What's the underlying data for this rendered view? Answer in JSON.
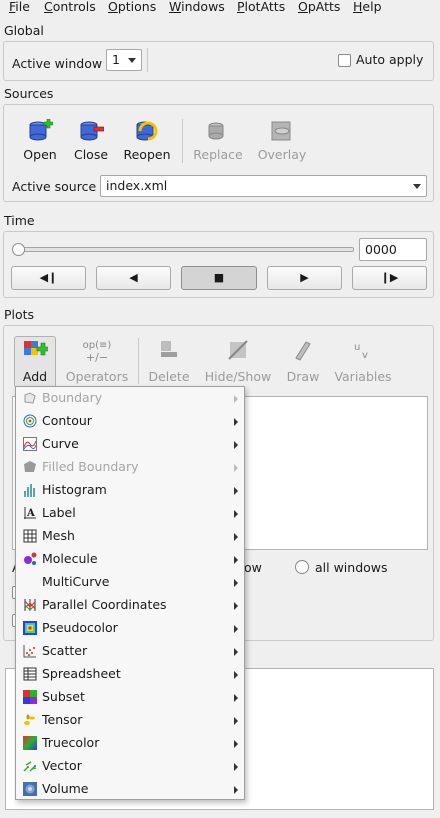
{
  "menubar": {
    "items": [
      {
        "label": "File",
        "ul": "F",
        "rest": "ile"
      },
      {
        "label": "Controls",
        "ul": "C",
        "rest": "ontrols"
      },
      {
        "label": "Options",
        "ul": "O",
        "rest": "ptions"
      },
      {
        "label": "Windows",
        "ul": "W",
        "rest": "indows"
      },
      {
        "label": "PlotAtts",
        "ul": "P",
        "rest": "lotAtts"
      },
      {
        "label": "OpAtts",
        "ul": "O",
        "rest": "pAtts"
      },
      {
        "label": "Help",
        "ul": "H",
        "rest": "elp"
      }
    ]
  },
  "global": {
    "title": "Global",
    "active_window_label": "Active window",
    "active_window_value": "1",
    "auto_apply_label": "Auto apply",
    "auto_apply_checked": false
  },
  "sources": {
    "title": "Sources",
    "buttons": {
      "open": "Open",
      "close": "Close",
      "reopen": "Reopen",
      "replace": "Replace",
      "overlay": "Overlay"
    },
    "active_source_label": "Active source",
    "active_source_value": "index.xml"
  },
  "time": {
    "title": "Time",
    "state_value": "0000",
    "slider_position": 0,
    "buttons": [
      "◀❙",
      "◀",
      "■",
      "▶",
      "❙▶"
    ]
  },
  "plots": {
    "title": "Plots",
    "toolbar": {
      "add": "Add",
      "operators": "Operators",
      "delete": "Delete",
      "hide_show": "Hide/Show",
      "draw": "Draw",
      "variables": "Variables"
    },
    "operators_icon_text": "op(≡)",
    "apply_suffix": "ow",
    "all_windows_label": "all windows",
    "partial_label_a": "A"
  },
  "add_menu": {
    "items": [
      {
        "label": "Boundary",
        "enabled": false,
        "icon": "boundary-icon"
      },
      {
        "label": "Contour",
        "enabled": true,
        "icon": "contour-icon"
      },
      {
        "label": "Curve",
        "enabled": true,
        "icon": "curve-icon"
      },
      {
        "label": "Filled Boundary",
        "enabled": false,
        "icon": "filled-boundary-icon"
      },
      {
        "label": "Histogram",
        "enabled": true,
        "icon": "histogram-icon"
      },
      {
        "label": "Label",
        "enabled": true,
        "icon": "label-icon"
      },
      {
        "label": "Mesh",
        "enabled": true,
        "icon": "mesh-icon"
      },
      {
        "label": "Molecule",
        "enabled": true,
        "icon": "molecule-icon"
      },
      {
        "label": "MultiCurve",
        "enabled": true,
        "icon": "none"
      },
      {
        "label": "Parallel Coordinates",
        "enabled": true,
        "icon": "parallel-coordinates-icon"
      },
      {
        "label": "Pseudocolor",
        "enabled": true,
        "icon": "pseudocolor-icon"
      },
      {
        "label": "Scatter",
        "enabled": true,
        "icon": "scatter-icon"
      },
      {
        "label": "Spreadsheet",
        "enabled": true,
        "icon": "spreadsheet-icon"
      },
      {
        "label": "Subset",
        "enabled": true,
        "icon": "subset-icon"
      },
      {
        "label": "Tensor",
        "enabled": true,
        "icon": "tensor-icon"
      },
      {
        "label": "Truecolor",
        "enabled": true,
        "icon": "truecolor-icon"
      },
      {
        "label": "Vector",
        "enabled": true,
        "icon": "vector-icon"
      },
      {
        "label": "Volume",
        "enabled": true,
        "icon": "volume-icon"
      }
    ]
  },
  "colors": {
    "window_bg": "#efefef",
    "menu_bg": "#f7f7f7",
    "disabled_text": "#a5a5a5",
    "add_icon_green": "#2fbf2f",
    "open_icon_blue": "#2a5bd7"
  }
}
